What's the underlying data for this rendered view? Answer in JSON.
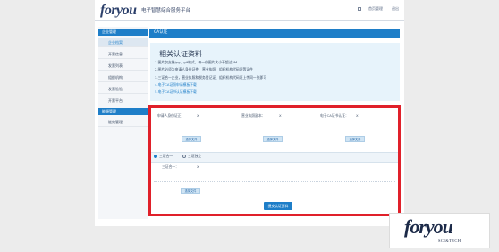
{
  "header": {
    "logo": "foryou",
    "system_title": "电子智慧综合服务平台",
    "links": [
      "首页管理",
      "退出"
    ]
  },
  "sidebar": {
    "groups": [
      {
        "label": "企业管理",
        "items": [
          "企业档案",
          "开票信息",
          "发票列表",
          "组织机构",
          "发票验验",
          "开票平台"
        ]
      },
      {
        "label": "能源管理",
        "items": [
          "能效管理"
        ]
      }
    ],
    "active_item": "企业档案"
  },
  "panel": {
    "title": "CA认证",
    "info": {
      "heading": "相关认证资料",
      "lines": [
        "1.图片仅支持jpg、gif格式，每一份图片大小不超过5M",
        "2.图片必须为申请人身份证件、营业执照、组织机构代码证等证件",
        "3.三证合一企业，营业执照和税务登记证、组织机构代码证上传同一张即可",
        "4.电子CA证照申请模板下载",
        "5.电子CA证书认证模板下载"
      ]
    },
    "upload_fields": [
      {
        "label": "申请人身份证正：",
        "value": "X",
        "button": "选择文件"
      },
      {
        "label": "营业执照副本：",
        "value": "X",
        "button": "选择文件"
      },
      {
        "label": "电子CA证书认证：",
        "value": "X",
        "button": "选择文件"
      }
    ],
    "cert_options": [
      "三证合一",
      "三证独立"
    ],
    "selected_option": "三证合一",
    "combined_field": {
      "label": "三证合一：",
      "value": "X",
      "button": "选择文件"
    },
    "submit_label": "提交认证资料"
  },
  "watermark": {
    "logo": "foryou",
    "subtitle": "SCI&TECH"
  }
}
